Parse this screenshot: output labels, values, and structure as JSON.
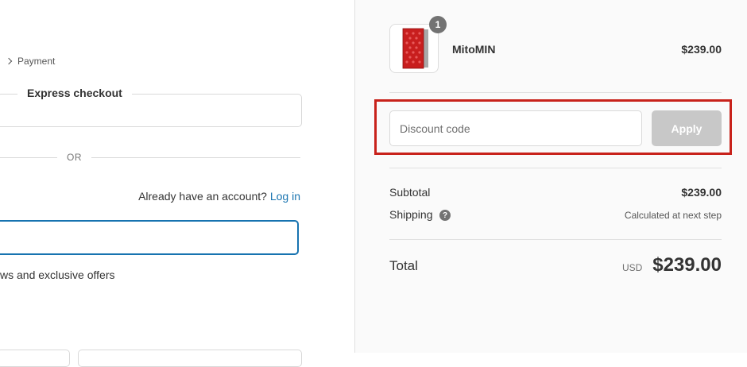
{
  "breadcrumb": {
    "last_label": "Payment"
  },
  "express_checkout": {
    "title": "Express checkout"
  },
  "divider_text": "OR",
  "account": {
    "prompt": "Already have an account?",
    "login_label": "Log in"
  },
  "newsletter": {
    "label_visible": "ws and exclusive offers"
  },
  "order": {
    "item": {
      "name": "MitoMIN",
      "price": "$239.00",
      "quantity": "1",
      "image_icon": "red-light-panel-product-image"
    },
    "discount": {
      "placeholder": "Discount code",
      "apply_label": "Apply"
    },
    "subtotal": {
      "label": "Subtotal",
      "value": "$239.00"
    },
    "shipping": {
      "label": "Shipping",
      "value": "Calculated at next step",
      "help_icon": "question-mark-icon"
    },
    "total": {
      "label": "Total",
      "currency": "USD",
      "amount": "$239.00"
    }
  },
  "colors": {
    "link": "#1773b0",
    "highlight": "#c8221b",
    "apply_disabled": "#c8c8c8",
    "product_red": "#c81e1e"
  }
}
